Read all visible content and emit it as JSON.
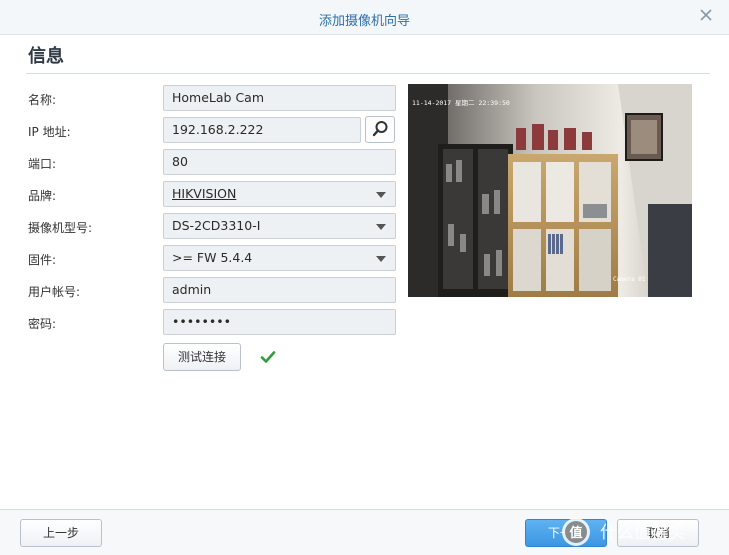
{
  "window": {
    "title": "添加摄像机向导"
  },
  "section": {
    "title": "信息"
  },
  "form": {
    "name": {
      "label": "名称:",
      "value": "HomeLab Cam"
    },
    "ip": {
      "label": "IP 地址:",
      "value": "192.168.2.222"
    },
    "port": {
      "label": "端口:",
      "value": "80"
    },
    "brand": {
      "label": "品牌:",
      "value": "HIKVISION"
    },
    "model": {
      "label": "摄像机型号:",
      "value": "DS-2CD3310-I"
    },
    "firmware": {
      "label": "固件:",
      "value": ">= FW 5.4.4"
    },
    "username": {
      "label": "用户帐号:",
      "value": "admin"
    },
    "password": {
      "label": "密码:",
      "value": "••••••••"
    },
    "test_button": "测试连接"
  },
  "preview": {
    "timestamp": "11-14-2017 星期二 22:39:50",
    "camera_label": "Camera 01"
  },
  "footer": {
    "prev": "上一步",
    "next": "下一步",
    "cancel": "取消"
  },
  "watermark": {
    "text": "值 什么值得买"
  },
  "colors": {
    "accent": "#3d96e2",
    "title": "#2d6fa8",
    "success": "#2e9d3a"
  }
}
